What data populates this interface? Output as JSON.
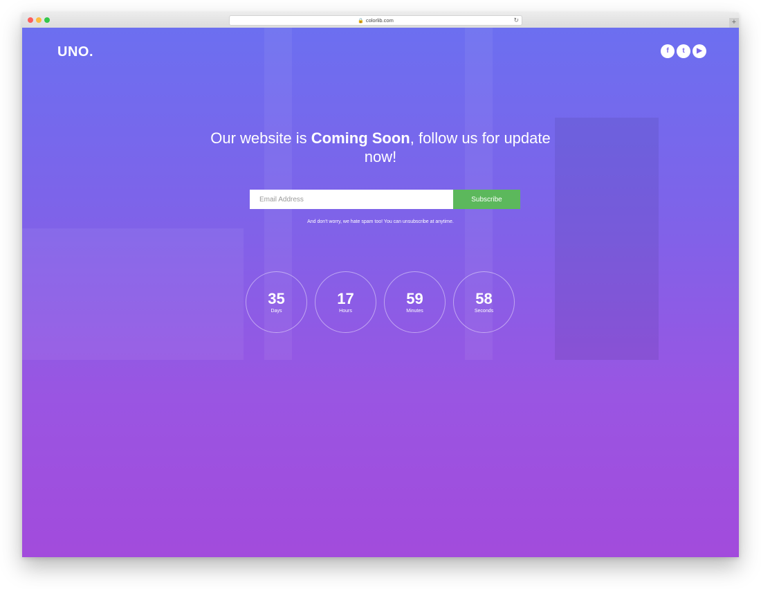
{
  "browser": {
    "url": "colorlib.com",
    "new_tab_label": "+"
  },
  "brand": {
    "logo": "UNO."
  },
  "social": [
    {
      "name": "facebook",
      "glyph": "f"
    },
    {
      "name": "twitter",
      "glyph": "t"
    },
    {
      "name": "youtube",
      "glyph": "▶"
    }
  ],
  "hero": {
    "headline_prefix": "Our website is ",
    "headline_bold": "Coming Soon",
    "headline_suffix": ", follow us for update now!"
  },
  "subscribe_form": {
    "email_placeholder": "Email Address",
    "email_value": "",
    "button_label": "Subscribe",
    "note": "And don't worry, we hate spam too! You can unsubscribe at anytime."
  },
  "countdown": [
    {
      "value": "35",
      "label": "Days"
    },
    {
      "value": "17",
      "label": "Hours"
    },
    {
      "value": "59",
      "label": "Minutes"
    },
    {
      "value": "58",
      "label": "Seconds"
    }
  ],
  "colors": {
    "gradient_top": "#6c6ff0",
    "gradient_bottom": "#a24bdc",
    "subscribe_button": "#5cb85c"
  }
}
